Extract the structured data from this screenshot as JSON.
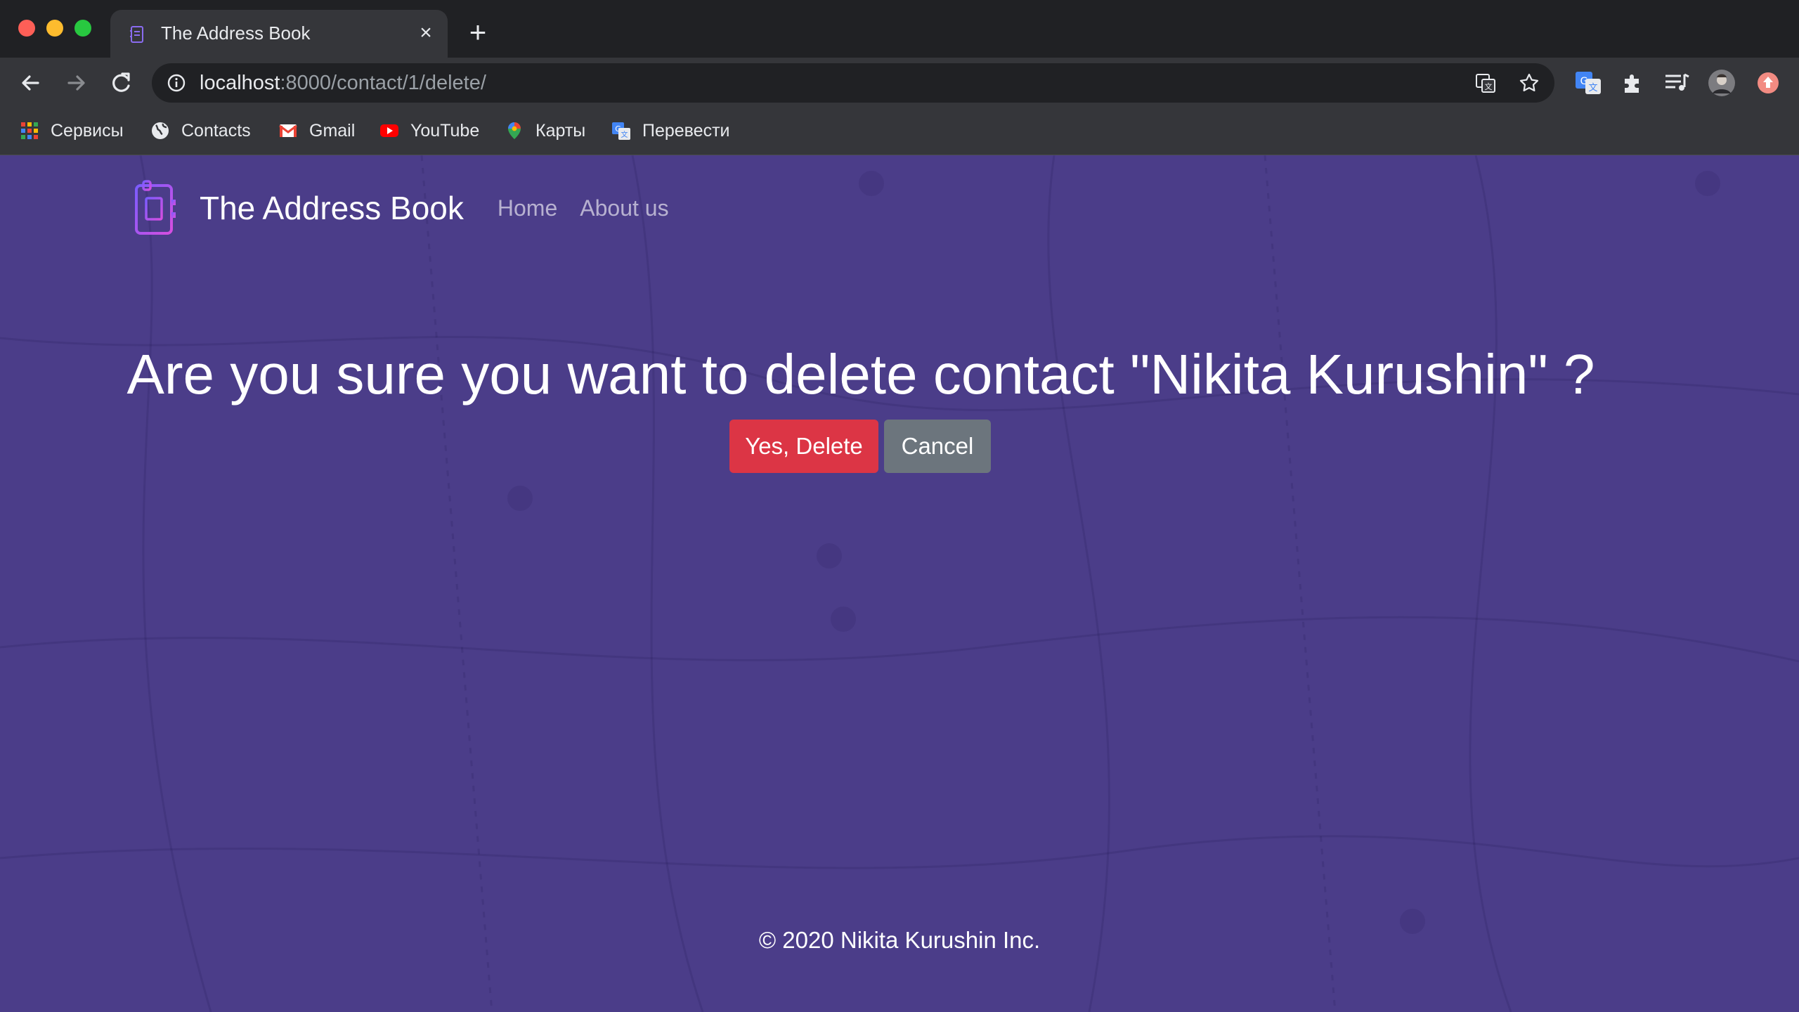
{
  "browser": {
    "tab": {
      "title": "The Address Book",
      "close": "×"
    },
    "new_tab": "+",
    "address": {
      "host": "localhost",
      "rest": ":8000/contact/1/delete/"
    },
    "bookmarks": [
      {
        "label": "Сервисы",
        "icon": "apps-grid-icon"
      },
      {
        "label": "Contacts",
        "icon": "globe-icon"
      },
      {
        "label": "Gmail",
        "icon": "gmail-icon"
      },
      {
        "label": "YouTube",
        "icon": "youtube-icon"
      },
      {
        "label": "Карты",
        "icon": "maps-pin-icon"
      },
      {
        "label": "Перевести",
        "icon": "translate-icon"
      }
    ]
  },
  "site": {
    "brand": "The Address Book",
    "nav": {
      "home": "Home",
      "about": "About us"
    },
    "question": "Are you sure you want to delete contact \"Nikita Kurushin\" ?",
    "buttons": {
      "delete": "Yes, Delete",
      "cancel": "Cancel"
    },
    "footer": "© 2020 Nikita Kurushin Inc."
  },
  "colors": {
    "page_bg": "#4b3d89",
    "delete": "#dc3545",
    "cancel": "#6c757d",
    "browser_dark": "#202124",
    "browser_toolbar": "#35363a"
  }
}
